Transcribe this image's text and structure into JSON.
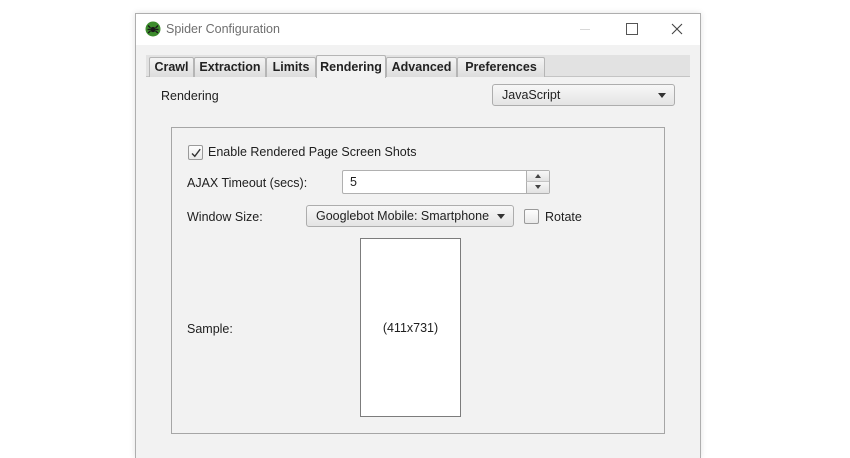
{
  "window": {
    "title": "Spider Configuration",
    "icon": "spider-logo-icon",
    "controls": [
      "minimize-icon",
      "maximize-icon",
      "close-icon"
    ]
  },
  "tabs": [
    {
      "label": "Crawl",
      "active": false
    },
    {
      "label": "Extraction",
      "active": false
    },
    {
      "label": "Limits",
      "active": false
    },
    {
      "label": "Rendering",
      "active": true
    },
    {
      "label": "Advanced",
      "active": false
    },
    {
      "label": "Preferences",
      "active": false
    }
  ],
  "rendering": {
    "label": "Rendering",
    "mode": "JavaScript"
  },
  "panel": {
    "screenshots": {
      "label": "Enable Rendered Page Screen Shots",
      "checked": true
    },
    "ajax_timeout": {
      "label": "AJAX Timeout (secs):",
      "value": "5"
    },
    "window_size": {
      "label": "Window Size:",
      "value": "Googlebot Mobile: Smartphone"
    },
    "rotate": {
      "label": "Rotate",
      "checked": false
    },
    "sample": {
      "label": "Sample:",
      "dimensions": "(411x731)"
    }
  },
  "colors": {
    "window_bg": "#f2f2f2",
    "logo_green": "#3c8c2c"
  }
}
